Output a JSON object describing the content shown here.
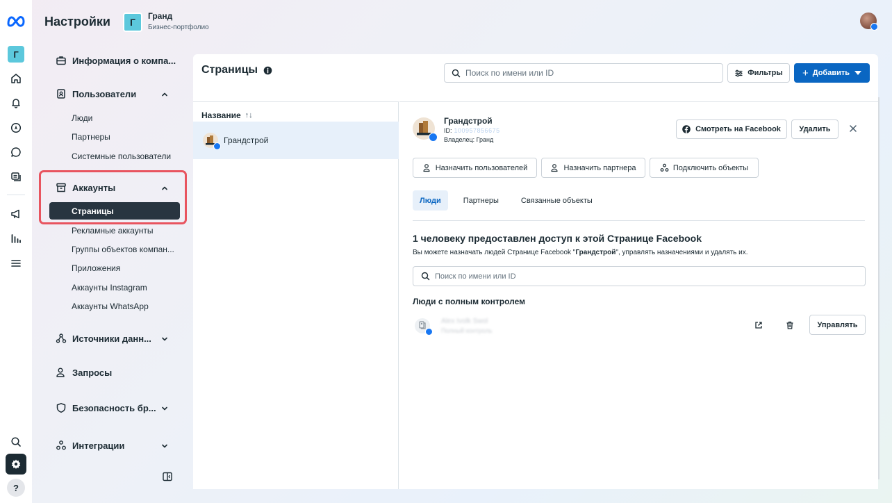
{
  "header": {
    "title": "Настройки",
    "account_initial": "Г",
    "account_name": "Гранд",
    "account_subtitle": "Бизнес-портфолио"
  },
  "rail": {
    "account_initial": "Г",
    "help_label": "?"
  },
  "nav": {
    "company_info": "Информация о компа...",
    "users": "Пользователи",
    "users_items": [
      "Люди",
      "Партнеры",
      "Системные пользователи"
    ],
    "accounts": "Аккаунты",
    "accounts_active": "Страницы",
    "accounts_items": [
      "Рекламные аккаунты",
      "Группы объектов компан...",
      "Приложения",
      "Аккаунты Instagram",
      "Аккаунты WhatsApp"
    ],
    "data_sources": "Источники данн...",
    "requests": "Запросы",
    "brand_safety": "Безопасность бр...",
    "integrations": "Интеграции"
  },
  "panel": {
    "title": "Страницы",
    "search_placeholder": "Поиск по имени или ID",
    "filters_label": "Фильтры",
    "add_label": "Добавить",
    "column_name": "Название",
    "sort_glyph": "↑↓",
    "rows": [
      {
        "name": "Грандстрой"
      }
    ]
  },
  "detail": {
    "page_name": "Грандстрой",
    "id_label": "ID:",
    "id_value": "100957856675",
    "owner": "Владелец: Гранд",
    "view_fb_label": "Смотреть на Facebook",
    "delete_label": "Удалить",
    "assign_users_label": "Назначить пользователей",
    "assign_partner_label": "Назначить партнера",
    "connect_assets_label": "Подключить объекты",
    "tabs": [
      "Люди",
      "Партнеры",
      "Связанные объекты"
    ],
    "access_title": "1 человеку предоставлен доступ к этой Странице Facebook",
    "access_desc_prefix": "Вы можете назначать людей Странице Facebook \"",
    "access_desc_bold": "Грандстрой",
    "access_desc_suffix": "\", управлять назначениями и удалять их.",
    "search_placeholder": "Поиск по имени или ID",
    "full_control_title": "Люди с полным контролем",
    "person_name": "Alex Ivolk Swol",
    "person_role": "Полный контроль",
    "manage_label": "Управлять"
  },
  "colors": {
    "accent_blue": "#0a66c2",
    "facebook_blue": "#1877f2",
    "dark_active": "#283540",
    "highlight_red": "#e8545f",
    "account_tile": "#5cc8dc"
  }
}
